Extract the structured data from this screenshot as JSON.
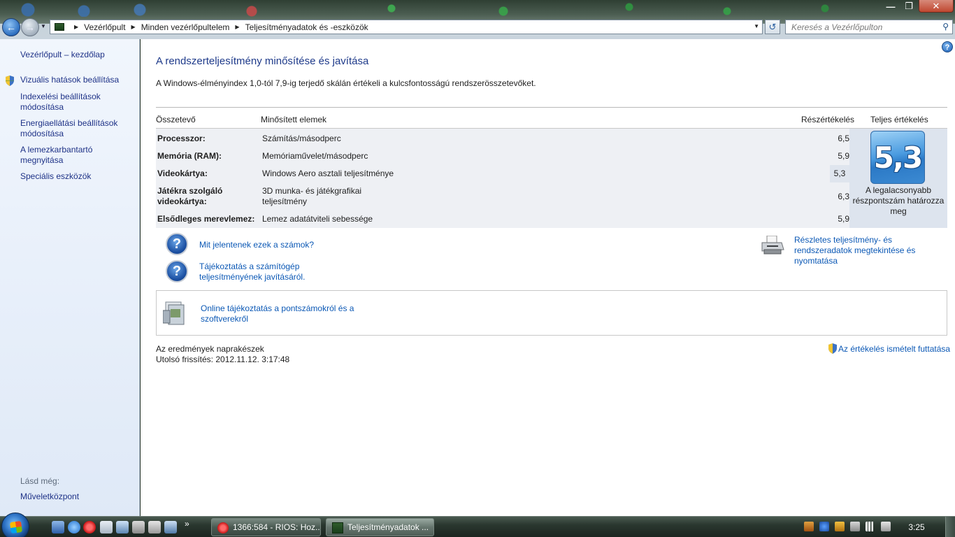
{
  "window": {
    "minimize_glyph": "—",
    "maximize_glyph": "❐",
    "close_glyph": "✕"
  },
  "address": {
    "crumbs": [
      "Vezérlőpult",
      "Minden vezérlőpultelem",
      "Teljesítményadatok és -eszközök"
    ],
    "search_placeholder": "Keresés a Vezérlőpulton"
  },
  "sidebar": {
    "home": "Vezérlőpult – kezdőlap",
    "items": [
      "Vizuális hatások beállítása",
      "Indexelési beállítások módosítása",
      "Energiaellátási beállítások módosítása",
      "A lemezkarbantartó megnyitása",
      "Speciális eszközök"
    ],
    "see_also_label": "Lásd még:",
    "see_also_items": [
      "Műveletközpont"
    ]
  },
  "main": {
    "title": "A rendszerteljesítmény minősítése és javítása",
    "subtitle": "A Windows-élményindex 1,0-tól 7,9-ig terjedő skálán értékeli a kulcsfontosságú rendszerösszetevőket.",
    "table": {
      "headers": {
        "component": "Összetevő",
        "rated": "Minősített elemek",
        "subscore": "Részértékelés",
        "basescore": "Teljes értékelés"
      },
      "rows": [
        {
          "component": "Processzor:",
          "description": "Számítás/másodperc",
          "score": "6,5"
        },
        {
          "component": "Memória (RAM):",
          "description": "Memóriaművelet/másodperc",
          "score": "5,9"
        },
        {
          "component": "Videokártya:",
          "description": "Windows Aero asztali teljesítménye",
          "score": "5,3"
        },
        {
          "component": "Játékra szolgáló videokártya:",
          "description": "3D munka- és játékgrafikai teljesítmény",
          "score": "6,3"
        },
        {
          "component": "Elsődleges merevlemez:",
          "description": "Lemez adatátviteli sebessége",
          "score": "5,9"
        }
      ],
      "base_score": "5,3",
      "base_caption": "A legalacsonyabb részpontszám határozza meg"
    },
    "links": {
      "meaning": "Mit jelentenek ezek a számok?",
      "improve": "Tájékoztatás a számítógép teljesítményének javításáról.",
      "details": "Részletes teljesítmény- és rendszeradatok megtekintése és nyomtatása",
      "online": "Online tájékoztatás a pontszámokról és a szoftverekről",
      "rerun": "Az értékelés ismételt futtatása"
    },
    "status": {
      "line1": "Az eredmények naprakészek",
      "line2": "Utolsó frissítés: 2012.11.12. 3:17:48"
    }
  },
  "taskbar": {
    "tasks": [
      "1366:584 - RIOS: Hoz...",
      "Teljesítményadatok ..."
    ],
    "clock": "3:25"
  },
  "colors": {
    "link": "#0b58b5",
    "title": "#1e3a8a",
    "sidebar_link": "#1e3287"
  }
}
